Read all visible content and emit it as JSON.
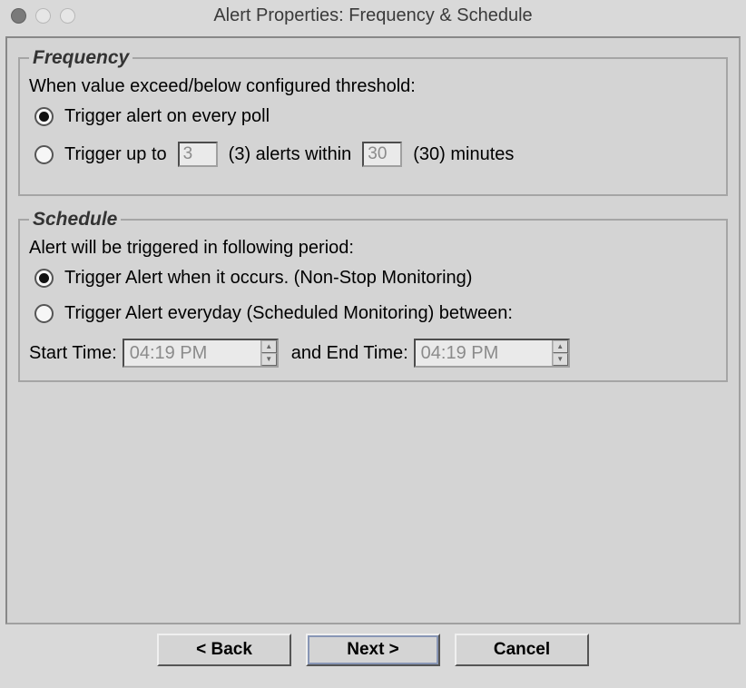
{
  "window": {
    "title": "Alert Properties: Frequency & Schedule"
  },
  "frequency": {
    "legend": "Frequency",
    "desc": "When value exceed/below configured threshold:",
    "opt_every_poll": "Trigger alert on every poll",
    "opt_up_to_pre": "Trigger up to",
    "alerts_count": "3",
    "opt_up_to_mid": "(3) alerts within",
    "minutes": "30",
    "opt_up_to_post": "(30) minutes"
  },
  "schedule": {
    "legend": "Schedule",
    "desc": "Alert will be triggered in following period:",
    "opt_nonstop": "Trigger Alert when it occurs. (Non-Stop Monitoring)",
    "opt_scheduled": "Trigger Alert everyday (Scheduled Monitoring) between:",
    "start_label": "Start Time:",
    "start_value": "04:19 PM",
    "and_end_label": "and End Time:",
    "end_value": "04:19 PM"
  },
  "buttons": {
    "back": "< Back",
    "next": "Next >",
    "cancel": "Cancel"
  }
}
